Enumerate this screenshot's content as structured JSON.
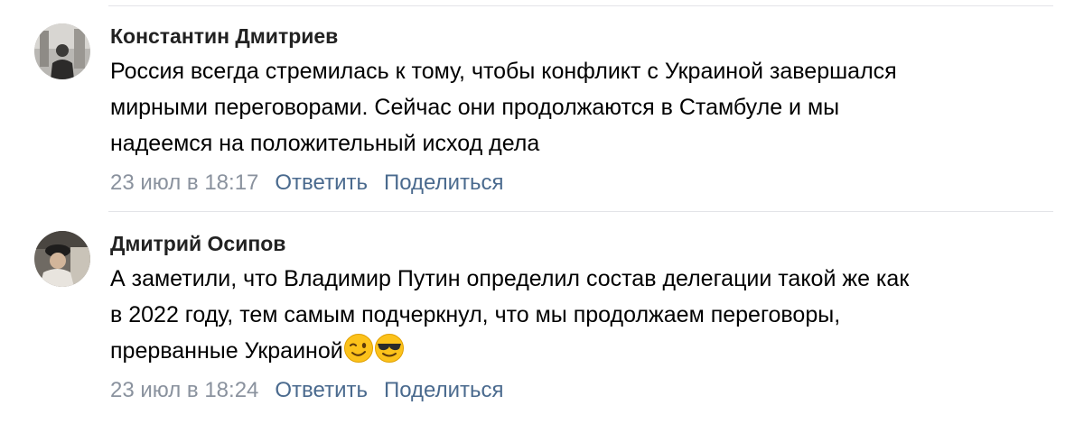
{
  "comments": [
    {
      "author": "Константин Дмитриев",
      "text": "Россия всегда стремилась к тому, чтобы конфликт с Украиной завершался\nмирными переговорами. Сейчас они продолжаются в Стамбуле и мы\nнадеемся на положительный исход дела",
      "date": "23 июл в 18:17",
      "reply_label": "Ответить",
      "share_label": "Поделиться"
    },
    {
      "author": "Дмитрий Осипов",
      "text": "А заметили, что Владимир Путин определил состав делегации такой же как\nв 2022 году, тем самым подчеркнул, что мы продолжаем переговоры,\nпрерванные Украиной",
      "emojis": [
        "winking-face-emoji",
        "smiling-face-with-sunglasses-emoji"
      ],
      "date": "23 июл в 18:24",
      "reply_label": "Ответить",
      "share_label": "Поделиться"
    }
  ],
  "colors": {
    "link": "#4a6a8e",
    "date": "#8a929e",
    "divider": "#e3e4e8"
  }
}
